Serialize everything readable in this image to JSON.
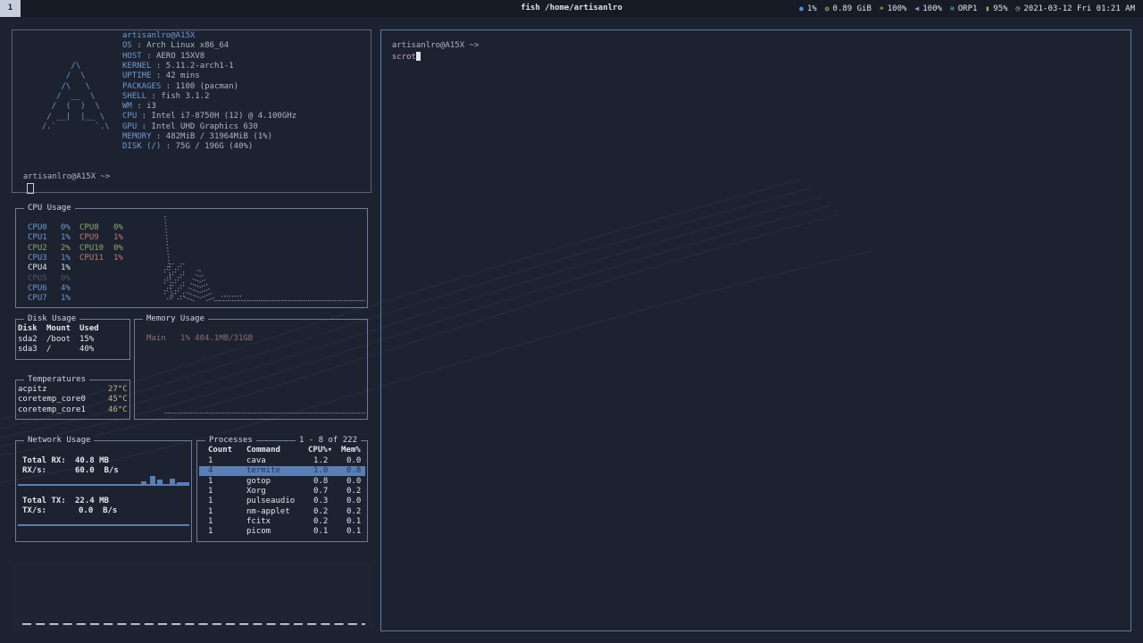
{
  "topbar": {
    "workspace": "1",
    "window_title": "fish /home/artisanlro",
    "status": [
      {
        "icon": "cpu-icon",
        "glyph": "●",
        "color": "#4f8fd8",
        "text": "1%"
      },
      {
        "icon": "memory-icon",
        "glyph": "◍",
        "color": "#8dbf5e",
        "text": "0.89 GiB"
      },
      {
        "icon": "brightness-icon",
        "glyph": "☀",
        "color": "#e8c24a",
        "text": "100%"
      },
      {
        "icon": "volume-icon",
        "glyph": "◀",
        "color": "#b27fd6",
        "text": "100%"
      },
      {
        "icon": "wifi-icon",
        "glyph": "≋",
        "color": "#6fb7e0",
        "text": "ORP1"
      },
      {
        "icon": "battery-icon",
        "glyph": "▮",
        "color": "#8dbf5e",
        "text": "95%"
      },
      {
        "icon": "clock-icon",
        "glyph": "◷",
        "color": "#c9ced8",
        "text": "2021-03-12 Fri 01:21 AM"
      }
    ]
  },
  "neofetch": {
    "user_host": "artisanlro@A15X",
    "logo": [
      "        /\\",
      "       /  \\",
      "      /\\   \\",
      "     /  __  \\",
      "    /  (  )  \\",
      "   / __|  |__ \\",
      "  /.`        `.\\"
    ],
    "info": [
      {
        "key": "OS",
        "value": "Arch Linux x86_64"
      },
      {
        "key": "HOST",
        "value": "AERO 15XV8"
      },
      {
        "key": "KERNEL",
        "value": "5.11.2-arch1-1"
      },
      {
        "key": "UPTIME",
        "value": "42 mins"
      },
      {
        "key": "PACKAGES",
        "value": "1100 (pacman)"
      },
      {
        "key": "SHELL",
        "value": "fish 3.1.2"
      },
      {
        "key": "WM",
        "value": "i3"
      },
      {
        "key": "CPU",
        "value": "Intel i7-8750H (12) @ 4.100GHz"
      },
      {
        "key": "GPU",
        "value": "Intel UHD Graphics 630"
      },
      {
        "key": "MEMORY",
        "value": "482MiB / 31964MiB (1%)"
      },
      {
        "key": "DISK (/)",
        "value": "75G / 196G (40%)"
      }
    ],
    "prompt": "artisanlro@A15X ~>"
  },
  "cpu": {
    "title": "CPU Usage",
    "col1": [
      {
        "name": "CPU0",
        "pct": "0%",
        "color": "#6f9ad0"
      },
      {
        "name": "CPU1",
        "pct": "1%",
        "color": "#6f9ad0"
      },
      {
        "name": "CPU2",
        "pct": "2%",
        "color": "#8fa86e"
      },
      {
        "name": "CPU3",
        "pct": "1%",
        "color": "#6f9ad0"
      },
      {
        "name": "CPU4",
        "pct": "1%",
        "color": "#e3e6ec"
      },
      {
        "name": "CPU5",
        "pct": "0%",
        "color": "#4b5566"
      },
      {
        "name": "CPU6",
        "pct": "4%",
        "color": "#6f9ad0"
      },
      {
        "name": "CPU7",
        "pct": "1%",
        "color": "#6f9ad0"
      }
    ],
    "col2": [
      {
        "name": "CPU8",
        "pct": "0%",
        "color": "#8fa86e"
      },
      {
        "name": "CPU9",
        "pct": "1%",
        "color": "#c27a6e"
      },
      {
        "name": "CPU10",
        "pct": "0%",
        "color": "#8fa86e"
      },
      {
        "name": "CPU11",
        "pct": "1%",
        "color": "#c27a6e"
      }
    ]
  },
  "disk": {
    "title": "Disk Usage",
    "headers": [
      "Disk",
      "Mount",
      "Used"
    ],
    "rows": [
      [
        "sda2",
        "/boot",
        "15%"
      ],
      [
        "sda3",
        "/",
        "40%"
      ]
    ]
  },
  "memory": {
    "title": "Memory Usage",
    "main": "Main   1% 404.1MB/31GB"
  },
  "temps": {
    "title": "Temperatures",
    "rows": [
      [
        "acpitz",
        "27°C"
      ],
      [
        "coretemp_core0",
        "45°C"
      ],
      [
        "coretemp_core1",
        "46°C"
      ]
    ]
  },
  "network": {
    "title": "Network Usage",
    "rx_total_label": "Total RX:",
    "rx_total": "40.8 MB",
    "rx_rate_label": "RX/s:",
    "rx_rate": "60.0  B/s",
    "tx_total_label": "Total TX:",
    "tx_total": "22.4 MB",
    "tx_rate_label": "TX/s:",
    "tx_rate": "0.0  B/s"
  },
  "processes": {
    "title": "Processes",
    "range": "1 - 8 of 222",
    "headers": [
      "Count",
      "Command",
      "CPU%▾",
      "Mem%"
    ],
    "rows": [
      [
        "1",
        "cava",
        "1.2",
        "0.0"
      ],
      [
        "4",
        "termite",
        "1.0",
        "0.8"
      ],
      [
        "1",
        "gotop",
        "0.8",
        "0.0"
      ],
      [
        "1",
        "Xorg",
        "0.7",
        "0.2"
      ],
      [
        "1",
        "pulseaudio",
        "0.3",
        "0.0"
      ],
      [
        "1",
        "nm-applet",
        "0.2",
        "0.2"
      ],
      [
        "1",
        "fcitx",
        "0.2",
        "0.1"
      ],
      [
        "1",
        "picom",
        "0.1",
        "0.1"
      ]
    ],
    "selected_row": 1
  },
  "terminal": {
    "prompt": "artisanlro@A15X ~>",
    "command": "scrot"
  }
}
